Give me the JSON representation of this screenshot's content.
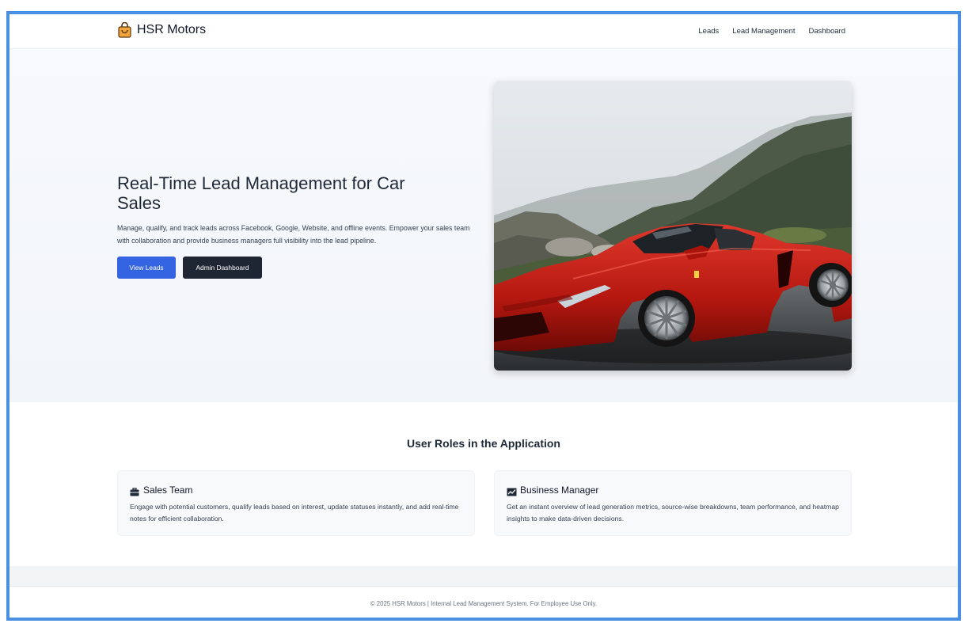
{
  "brand": {
    "name": "HSR Motors",
    "icon": "shopping-bag-icon"
  },
  "nav": {
    "links": [
      "Leads",
      "Lead Management",
      "Dashboard"
    ]
  },
  "hero": {
    "title": "Real-Time Lead Management for Car Sales",
    "description": "Manage, qualify, and track leads across Facebook, Google, Website, and offline events. Empower your sales team with collaboration and provide business managers full visibility into the lead pipeline.",
    "primary_button": "View Leads",
    "secondary_button": "Admin Dashboard",
    "image": "red-sports-car-photo"
  },
  "roles": {
    "title": "User Roles in the Application",
    "cards": [
      {
        "icon": "briefcase-icon",
        "title": "Sales Team",
        "description": "Engage with potential customers, qualify leads based on interest, update statuses instantly, and add real-time notes for efficient collaboration."
      },
      {
        "icon": "chart-icon",
        "title": "Business Manager",
        "description": "Get an instant overview of lead generation metrics, source-wise breakdowns, team performance, and heatmap insights to make data-driven decisions."
      }
    ]
  },
  "footer": {
    "text": "© 2025 HSR Motors | Internal Lead Management System. For Employee Use Only."
  },
  "colors": {
    "primary": "#3564e3",
    "dark": "#1e2533",
    "frame": "#4a90e2",
    "car": "#c0211a"
  }
}
